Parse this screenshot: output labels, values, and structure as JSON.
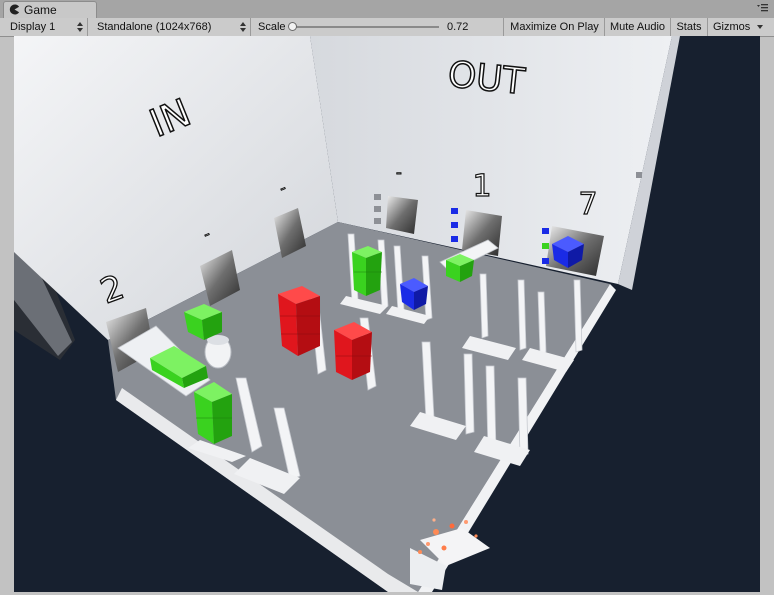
{
  "window": {
    "tab_label": "Game",
    "tab_icon": "pacman-icon",
    "menu_icon": "menu-icon"
  },
  "toolbar": {
    "display_label": "Display 1",
    "resolution_label": "Standalone (1024x768)",
    "scale_label": "Scale",
    "scale_value": "0.72",
    "maximize_label": "Maximize On Play",
    "mute_label": "Mute Audio",
    "stats_label": "Stats",
    "gizmos_label": "Gizmos"
  },
  "scene": {
    "wall_in_label": "IN",
    "wall_out_label": "OUT",
    "door_in_2_label": "2",
    "door_out_1_label": "1",
    "door_out_7_label": "7",
    "door_mark": "-",
    "colors": {
      "background": "#17202f",
      "floor": "#8b8f96",
      "wall": "#e4e6ea",
      "red": "#e0161d",
      "green": "#3ad21f",
      "blue": "#1a2be6"
    }
  }
}
